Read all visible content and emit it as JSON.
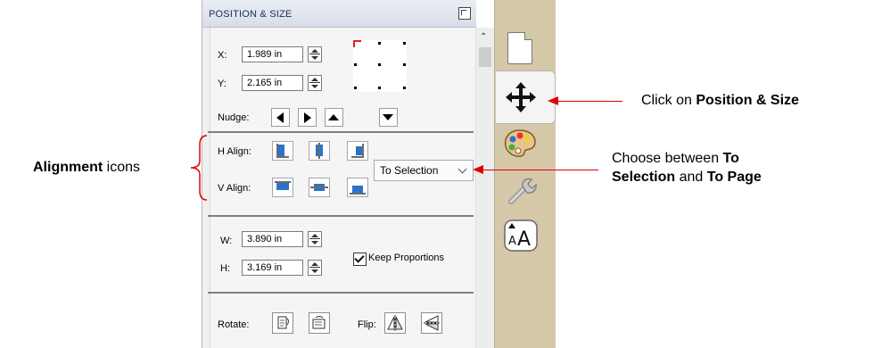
{
  "panel": {
    "title": "POSITION & SIZE",
    "position": {
      "x_label": "X:",
      "x_value": "1.989 in",
      "y_label": "Y:",
      "y_value": "2.165 in"
    },
    "nudge": {
      "label": "Nudge:"
    },
    "align": {
      "h_label": "H Align:",
      "v_label": "V Align:",
      "dropdown_value": "To Selection"
    },
    "size": {
      "w_label": "W:",
      "w_value": "3.890 in",
      "h_label": "H:",
      "h_value": "3.169 in",
      "keep_proportions_label": "Keep Proportions",
      "keep_proportions_checked": true
    },
    "transform": {
      "rotate_label": "Rotate:",
      "flip_label": "Flip:"
    }
  },
  "tabs": [
    {
      "icon": "document-icon"
    },
    {
      "icon": "move-arrows-icon",
      "active": true
    },
    {
      "icon": "palette-icon"
    },
    {
      "icon": "wrench-icon"
    },
    {
      "icon": "text-size-icon"
    }
  ],
  "annotations": {
    "left": {
      "bold": "Alignment",
      "rest": " icons"
    },
    "click": {
      "prefix": "Click on ",
      "bold": "Position & Size"
    },
    "choose": {
      "line1_prefix": "Choose between ",
      "line1_bold": "To",
      "line2_bold_a": "Selection",
      "line2_mid": " and ",
      "line2_bold_b": "To Page"
    }
  },
  "colors": {
    "annotation_arrow": "#e00000",
    "align_icon_blue": "#2b73c6",
    "tab_strip": "#d4c8a8"
  }
}
